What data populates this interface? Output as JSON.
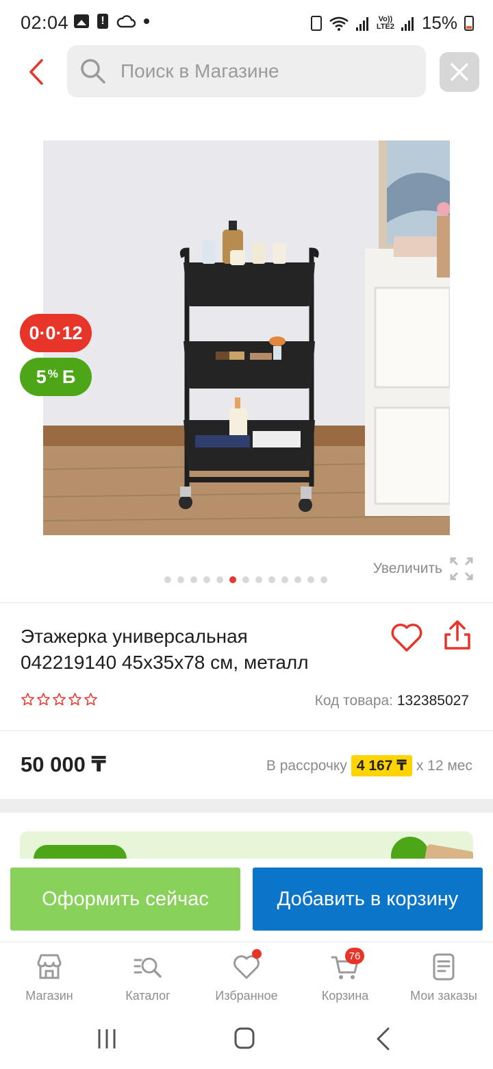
{
  "status_bar": {
    "time": "02:04",
    "battery_percent": "15%",
    "network": "LTE2",
    "network_prefix": "Vo))",
    "icons": [
      "image-icon",
      "alert-icon",
      "cloud-icon",
      "dot-icon",
      "wifi-icon",
      "signal-icon",
      "battery-icon"
    ]
  },
  "search": {
    "placeholder": "Поиск в Магазине",
    "value": ""
  },
  "badges": {
    "installment": "0·0·12",
    "bonus_value": "5",
    "bonus_percent": "%",
    "bonus_currency": "Б"
  },
  "gallery": {
    "zoom_label": "Увеличить",
    "total_images": 13,
    "active_index": 5
  },
  "product": {
    "title_line1": "Этажерка универсальная",
    "title_line2": "042219140 45x35x78 см, металл",
    "rating": 0,
    "rating_max": 5,
    "sku_label": "Код товара:",
    "sku_value": "132385027",
    "price": "50 000 ₸",
    "installment_prefix": "В рассрочку",
    "installment_amount": "4 167 ₸",
    "installment_suffix": "x 12 мес"
  },
  "actions": {
    "checkout": "Оформить сейчас",
    "add_to_cart": "Добавить в корзину"
  },
  "bottom_nav": {
    "shop": "Магазин",
    "catalog": "Каталог",
    "favorites": "Избранное",
    "cart": "Корзина",
    "cart_count": "76",
    "orders": "Мои заказы"
  },
  "colors": {
    "accent_red": "#e8352a",
    "bonus_green": "#4ca617",
    "checkout_green": "#88d15a",
    "cart_blue": "#0b75c9",
    "highlight_yellow": "#ffd400"
  }
}
